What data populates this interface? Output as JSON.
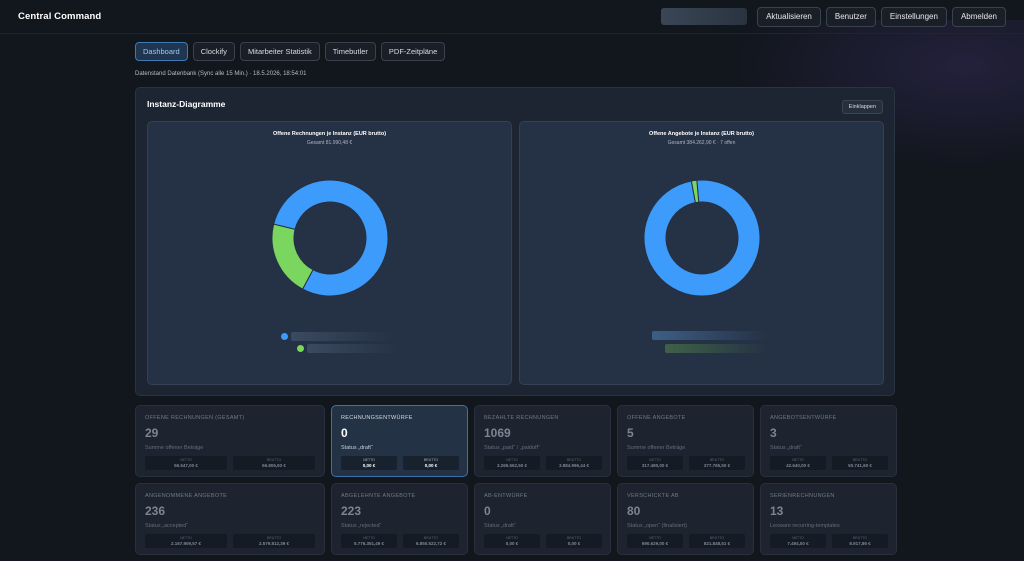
{
  "app": {
    "title": "Central Command"
  },
  "header": {
    "buttons": [
      {
        "label": "Aktualisieren"
      },
      {
        "label": "Benutzer"
      },
      {
        "label": "Einstellungen"
      },
      {
        "label": "Abmelden"
      }
    ]
  },
  "tabs": [
    {
      "label": "Dashboard",
      "active": true
    },
    {
      "label": "Clockify",
      "active": false
    },
    {
      "label": "Mitarbeiter Statistik",
      "active": false
    },
    {
      "label": "Timebutler",
      "active": false
    },
    {
      "label": "PDF-Zeitpläne",
      "active": false
    }
  ],
  "sync_info": "Datenstand Datenbank (Sync alle 15 Min.) · 18.5.2026, 18:54:01",
  "panel": {
    "title": "Instanz-Diagramme",
    "collapse_label": "Einklappen"
  },
  "colors": {
    "blue": "#3d9bfb",
    "green": "#7ad65f",
    "accent": "#3e79b4"
  },
  "chart_data": [
    {
      "type": "pie",
      "title": "Offene Rechnungen je Instanz (EUR brutto)",
      "subtitle": "Gesamt 81.990,48 €",
      "slices": [
        {
          "value": 0.79,
          "color": "#3d9bfb"
        },
        {
          "value": 0.21,
          "color": "#7ad65f"
        }
      ]
    },
    {
      "type": "pie",
      "title": "Offene Angebote je Instanz (EUR brutto)",
      "subtitle": "Gesamt 384.262,90 € · 7 offen",
      "slices": [
        {
          "value": 0.985,
          "color": "#3d9bfb"
        },
        {
          "value": 0.015,
          "color": "#7ad65f"
        }
      ]
    }
  ],
  "cards": [
    {
      "label": "OFFENE RECHNUNGEN (GESAMT)",
      "value": "29",
      "desc": "Summe offener Beträge",
      "netto": "56.547,00 €",
      "brutto": "66.806,93 €",
      "netto_label": "NETTO",
      "brutto_label": "BRUTTO"
    },
    {
      "label": "RECHNUNGSENTWÜRFE",
      "value": "0",
      "desc": "Status „draft“",
      "netto": "0,00 €",
      "brutto": "0,00 €",
      "netto_label": "NETTO",
      "brutto_label": "BRUTTO",
      "highlight": true
    },
    {
      "label": "BEZAHLTE RECHNUNGEN",
      "value": "1069",
      "desc": "Status „paid“ / „paidoff“",
      "netto": "3.265.562,50 €",
      "brutto": "3.884.996,44 €",
      "netto_label": "NETTO",
      "brutto_label": "BRUTTO"
    },
    {
      "label": "OFFENE ANGEBOTE",
      "value": "5",
      "desc": "Summe offener Beträge",
      "netto": "317.480,00 €",
      "brutto": "377.765,50 €",
      "netto_label": "NETTO",
      "brutto_label": "BRUTTO"
    },
    {
      "label": "ANGEBOTSENTWÜRFE",
      "value": "3",
      "desc": "Status „draft“",
      "netto": "42.640,00 €",
      "brutto": "50.741,60 €",
      "netto_label": "NETTO",
      "brutto_label": "BRUTTO"
    },
    {
      "label": "ANGENOMMENE ANGEBOTE",
      "value": "236",
      "desc": "Status „accepted“",
      "netto": "2.167.909,57 €",
      "brutto": "2.579.812,39 €",
      "netto_label": "NETTO",
      "brutto_label": "BRUTTO"
    },
    {
      "label": "ABGELEHNTE ANGEBOTE",
      "value": "223",
      "desc": "Status „rejected“",
      "netto": "5.776.351,49 €",
      "brutto": "6.850.522,72 €",
      "netto_label": "NETTO",
      "brutto_label": "BRUTTO"
    },
    {
      "label": "AB-ENTWÜRFE",
      "value": "0",
      "desc": "Status „draft“",
      "netto": "0,00 €",
      "brutto": "0,00 €",
      "netto_label": "NETTO",
      "brutto_label": "BRUTTO"
    },
    {
      "label": "VERSCHICKTE AB",
      "value": "80",
      "desc": "Status „open“ (finalisiert)",
      "netto": "690.629,00 €",
      "brutto": "821.848,51 €",
      "netto_label": "NETTO",
      "brutto_label": "BRUTTO"
    },
    {
      "label": "SERIENRECHNUNGEN",
      "value": "13",
      "desc": "Lexware recurring-templates",
      "netto": "7.494,00 €",
      "brutto": "8.917,86 €",
      "netto_label": "NETTO",
      "brutto_label": "BRUTTO"
    }
  ]
}
